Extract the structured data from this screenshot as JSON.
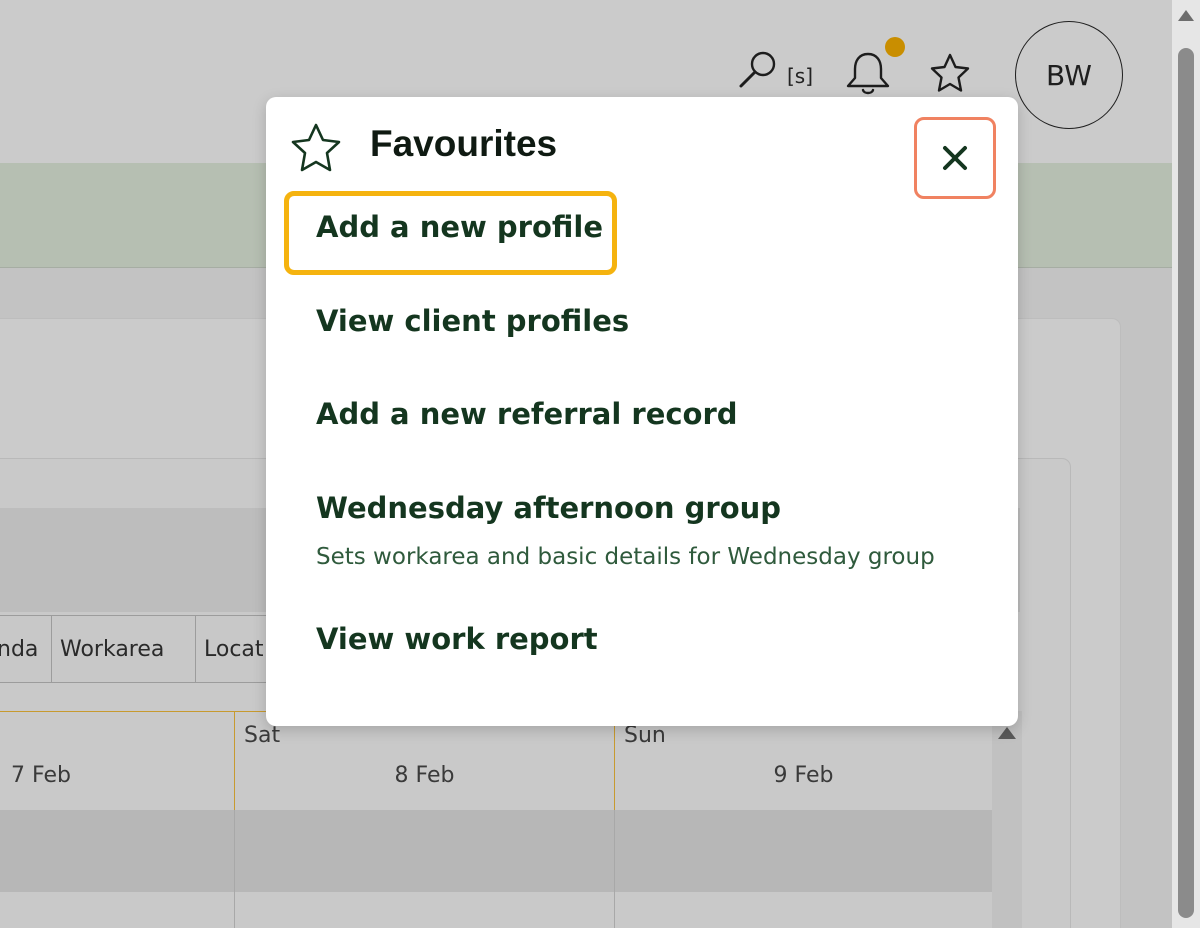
{
  "header": {
    "search_shortcut": "[s]",
    "avatar_initials": "BW"
  },
  "table": {
    "columns": [
      "nda",
      "Workarea",
      "Locat"
    ]
  },
  "calendar": {
    "days": [
      {
        "day": "",
        "date": "7 Feb"
      },
      {
        "day": "Sat",
        "date": "8 Feb"
      },
      {
        "day": "Sun",
        "date": "9 Feb"
      }
    ]
  },
  "favourites": {
    "title": "Favourites",
    "close_icon": "close-icon",
    "items": [
      {
        "label": "Add a new profile"
      },
      {
        "label": "View client profiles"
      },
      {
        "label": "Add a new referral record"
      },
      {
        "label": "Wednesday afternoon group",
        "description": "Sets workarea and basic details for Wednesday group"
      },
      {
        "label": "View work report"
      }
    ]
  },
  "colors": {
    "accent_highlight": "#f5b30f",
    "close_highlight": "#f08261",
    "notification_dot": "#c98e00",
    "calendar_line": "#c79a2f",
    "item_text": "#14361f"
  }
}
